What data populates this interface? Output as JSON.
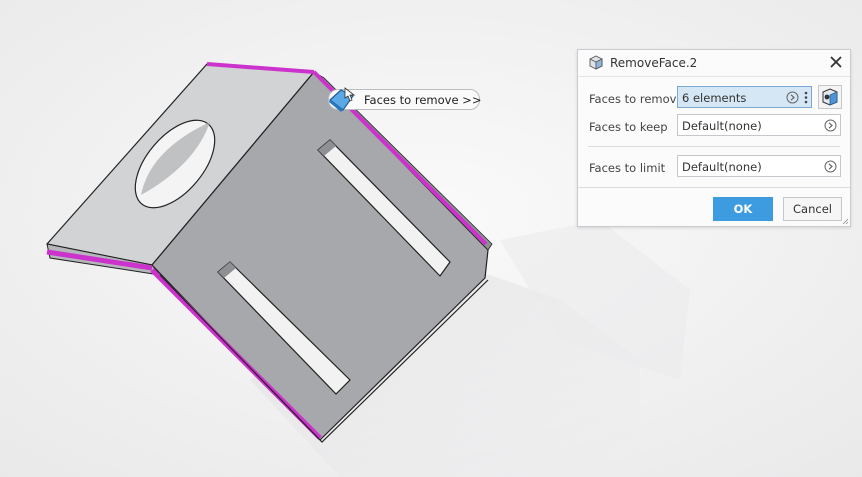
{
  "viewport": {
    "part_color": "#a6a8ab",
    "highlight_color": "#cc33cc",
    "background_color": "#f5f5f5"
  },
  "tooltip": {
    "label": "Faces to remove >>",
    "icon": "face-selection-icon"
  },
  "dialog": {
    "title": "RemoveFace.2",
    "title_icon": "remove-face-icon",
    "close_icon": "close-icon",
    "rows": {
      "faces_to_remove": {
        "label": "Faces to remove",
        "value": "6 elements"
      },
      "faces_to_keep": {
        "label": "Faces to keep",
        "value": "Default(none)"
      },
      "faces_to_limit": {
        "label": "Faces to limit",
        "value": "Default(none)"
      }
    },
    "ok_label": "OK",
    "cancel_label": "Cancel",
    "accent_color": "#3d9be0"
  }
}
